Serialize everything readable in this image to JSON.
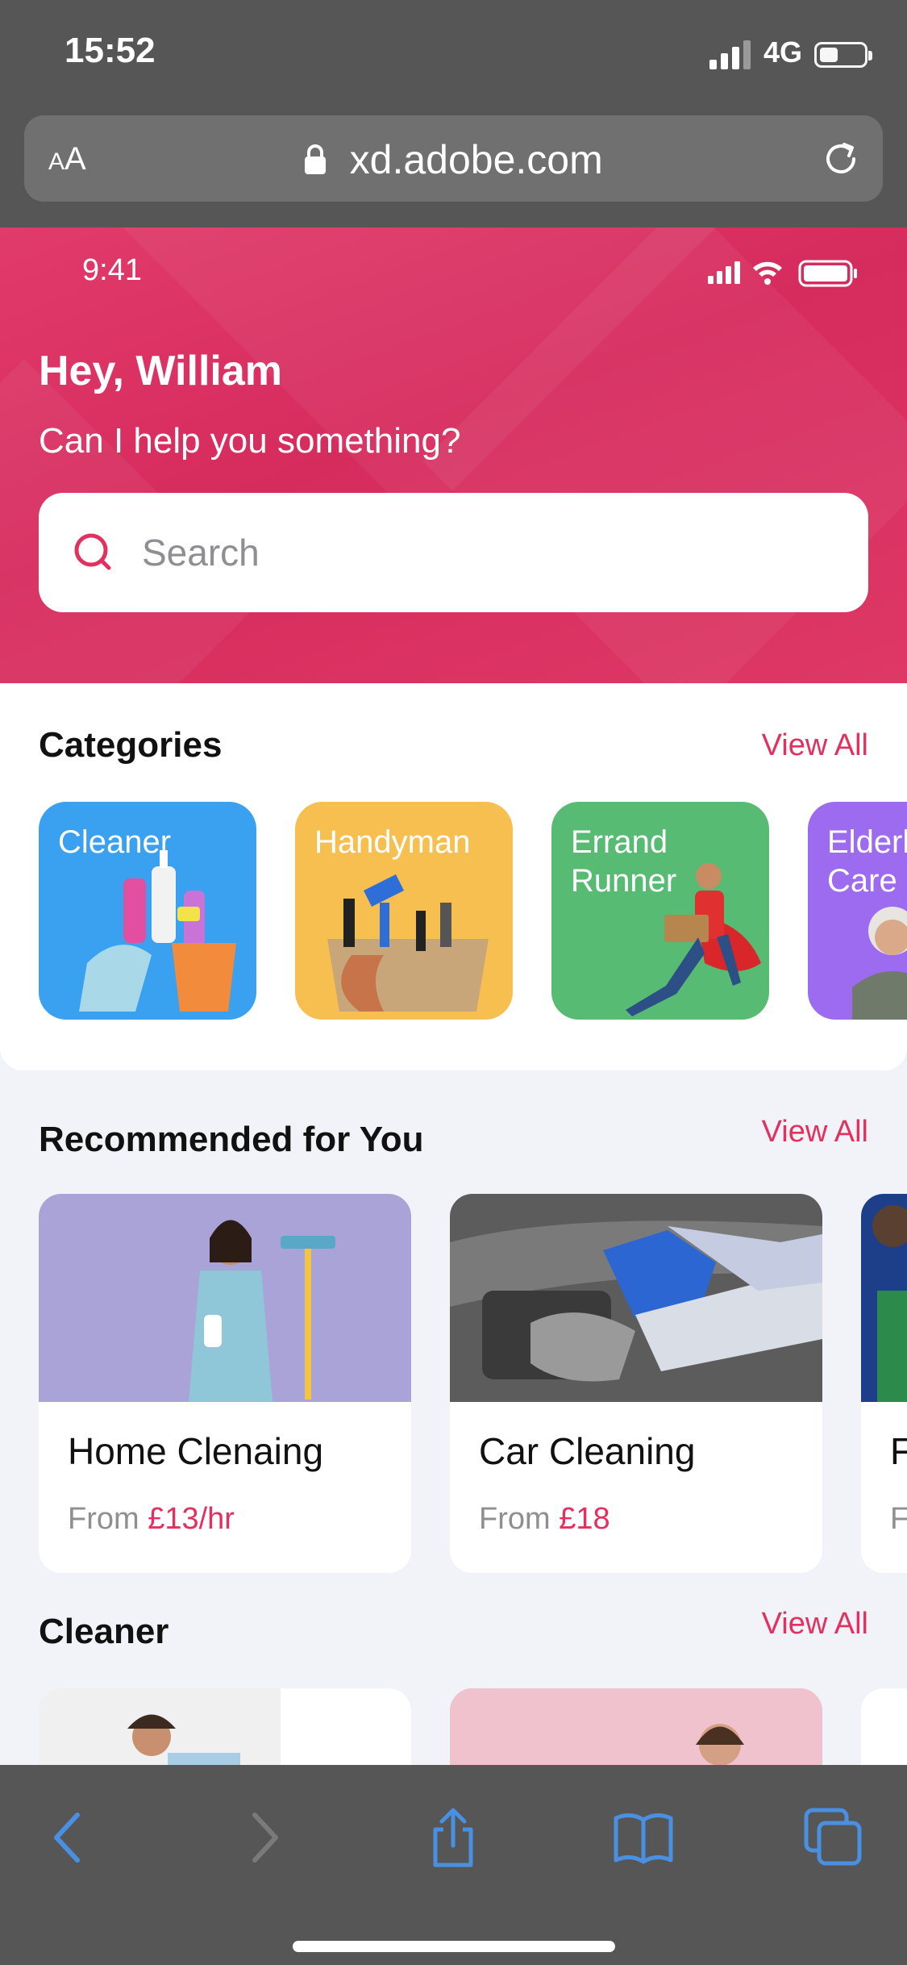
{
  "browser": {
    "status_time": "15:52",
    "network": "4G",
    "url": "xd.adobe.com",
    "text_size_label_small": "A",
    "text_size_label_large": "A"
  },
  "app": {
    "status_time": "9:41",
    "greeting": "Hey, William",
    "subtitle": "Can I help you something?",
    "search": {
      "placeholder": "Search"
    },
    "categories": {
      "title": "Categories",
      "view_all": "View All",
      "items": [
        {
          "label": "Cleaner",
          "color": "#3aa0f0"
        },
        {
          "label": "Handyman",
          "color": "#f7bf4f"
        },
        {
          "label": "Errand\nRunner",
          "color": "#58bb73"
        },
        {
          "label": "Elderl\nCare",
          "color": "#9d6bef"
        }
      ]
    },
    "recommended": {
      "title": "Recommended for You",
      "view_all": "View All",
      "items": [
        {
          "title": "Home Clenaing",
          "price_prefix": "From ",
          "price": "£13/hr"
        },
        {
          "title": "Car Cleaning",
          "price_prefix": "From ",
          "price": "£18"
        },
        {
          "title": "F",
          "price_prefix": "F",
          "price": ""
        }
      ]
    },
    "cleaner": {
      "title": "Cleaner",
      "view_all": "View All"
    }
  },
  "colors": {
    "accent": "#e2315f",
    "hero_start": "#e13b6b",
    "safari_chrome": "#565656",
    "toolbar_icon": "#4a90e2"
  },
  "icons": [
    "lock-icon",
    "reload-icon",
    "search-icon",
    "back-icon",
    "forward-icon",
    "share-icon",
    "bookmarks-icon",
    "tabs-icon"
  ]
}
